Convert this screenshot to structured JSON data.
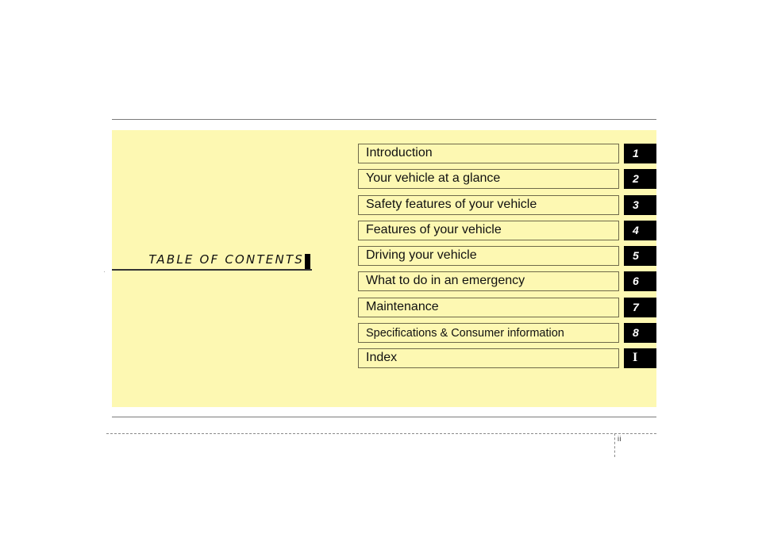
{
  "document": {
    "title": "TABLE OF CONTENTS",
    "page_number": "ii",
    "colors": {
      "panel_background": "#fdf8b2",
      "tab_background": "#000000",
      "tab_text": "#ffffff",
      "rule": "#7a7a7a"
    }
  },
  "chapters": [
    {
      "label": "Introduction",
      "number": "1"
    },
    {
      "label": "Your vehicle at a glance",
      "number": "2"
    },
    {
      "label": "Safety features of your vehicle",
      "number": "3"
    },
    {
      "label": "Features of your vehicle",
      "number": "4"
    },
    {
      "label": "Driving your vehicle",
      "number": "5"
    },
    {
      "label": "What to do in an emergency",
      "number": "6"
    },
    {
      "label": "Maintenance",
      "number": "7"
    },
    {
      "label": "Specifications & Consumer information",
      "number": "8"
    },
    {
      "label": "Index",
      "number": "I"
    }
  ]
}
